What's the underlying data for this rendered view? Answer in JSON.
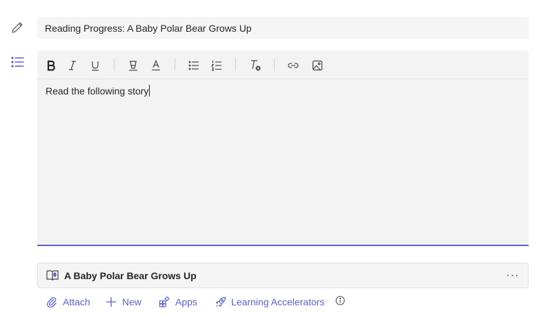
{
  "title_field": {
    "value": "Reading Progress: A Baby Polar Bear Grows Up"
  },
  "editor": {
    "body_text": "Read the following story"
  },
  "toolbar": {
    "buttons": [
      "bold-icon",
      "italic-icon",
      "underline-icon",
      "highlight-icon",
      "font-color-icon",
      "bulleted-list-icon",
      "numbered-list-icon",
      "clear-formatting-icon",
      "link-icon",
      "image-icon"
    ]
  },
  "resource": {
    "title": "A Baby Polar Bear Grows Up",
    "more_label": "···"
  },
  "actions": {
    "attach": "Attach",
    "new": "New",
    "apps": "Apps",
    "learning_accelerators": "Learning Accelerators"
  },
  "colors": {
    "accent": "#5b5fc7",
    "field_bg": "#f5f5f5",
    "text": "#242424"
  }
}
